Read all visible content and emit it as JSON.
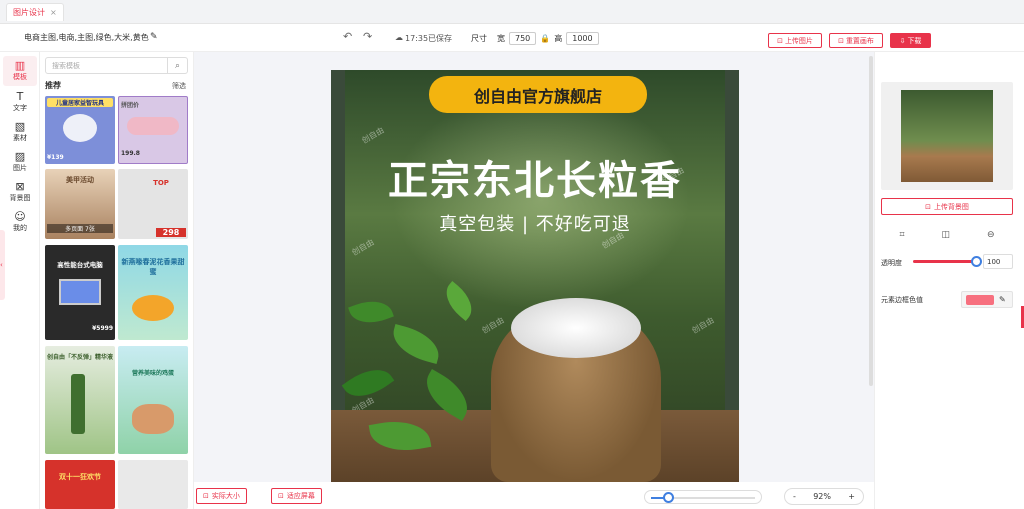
{
  "tab": {
    "label": "图片设计",
    "close": "×"
  },
  "toolbar": {
    "tags": "电商主图,电商,主图,绿色,大米,黄色",
    "undo": "↶",
    "redo": "↷",
    "save_status": "17:35已保存",
    "size_label": "尺寸",
    "width_label": "宽",
    "width_value": "750",
    "height_label": "高",
    "height_value": "1000",
    "upload_image": "上传图片",
    "reset_canvas": "重置画布",
    "download": "下载"
  },
  "leftnav": {
    "items": [
      {
        "label": "模板",
        "icon": "template-icon"
      },
      {
        "label": "文字",
        "icon": "text-icon"
      },
      {
        "label": "素材",
        "icon": "material-icon"
      },
      {
        "label": "图片",
        "icon": "image-icon"
      },
      {
        "label": "背景图",
        "icon": "background-icon"
      },
      {
        "label": "我的",
        "icon": "user-icon"
      }
    ]
  },
  "templates": {
    "search_placeholder": "搜索模板",
    "section_title": "推荐",
    "filter_label": "筛选",
    "items": [
      {
        "title": "儿童居家益智玩具",
        "price": "¥139",
        "bg": "#7d8fd9"
      },
      {
        "title": "拼团价",
        "price": "199.8",
        "bg": "#c9a3d8"
      },
      {
        "title": "美甲活动",
        "price": "多页面 7张",
        "bg": "#c9a788"
      },
      {
        "title": "TOP",
        "price": "298",
        "bg": "#d8d8d8"
      },
      {
        "title": "高性能台式电脑",
        "price": "¥5999",
        "bg": "#2a2a2a"
      },
      {
        "title": "新燕喙春泥花香果甜蜜",
        "price": "",
        "bg": "#78c7d8"
      },
      {
        "title": "创自由「不反弹」精华液",
        "price": "",
        "bg": "#7ea86a"
      },
      {
        "title": "营养美味的鸡蛋",
        "price": "",
        "bg": "#8ccfb8"
      },
      {
        "title": "双十一狂欢节",
        "price": "",
        "bg": "#d6322b"
      },
      {
        "title": "",
        "price": "",
        "bg": "#e9e9e9"
      }
    ]
  },
  "poster": {
    "shop_name": "创自由官方旗舰店",
    "headline": "正宗东北长粒香",
    "subline": "真空包装 | 不好吃可退",
    "watermark": "创自由"
  },
  "zoombar": {
    "actual_size": "实际大小",
    "fit_screen": "适应屏幕",
    "zoom_minus": "-",
    "zoom_value": "92%",
    "zoom_plus": "+",
    "zoom_level": 0.16
  },
  "rightpanel": {
    "upload_bg": "上传背景图",
    "opacity_label": "透明度",
    "opacity_value": "100",
    "border_color_label": "元素边框色值",
    "border_color": "#f7707f"
  },
  "colors": {
    "accent": "#e8334a",
    "blue": "#3f7fe0"
  }
}
